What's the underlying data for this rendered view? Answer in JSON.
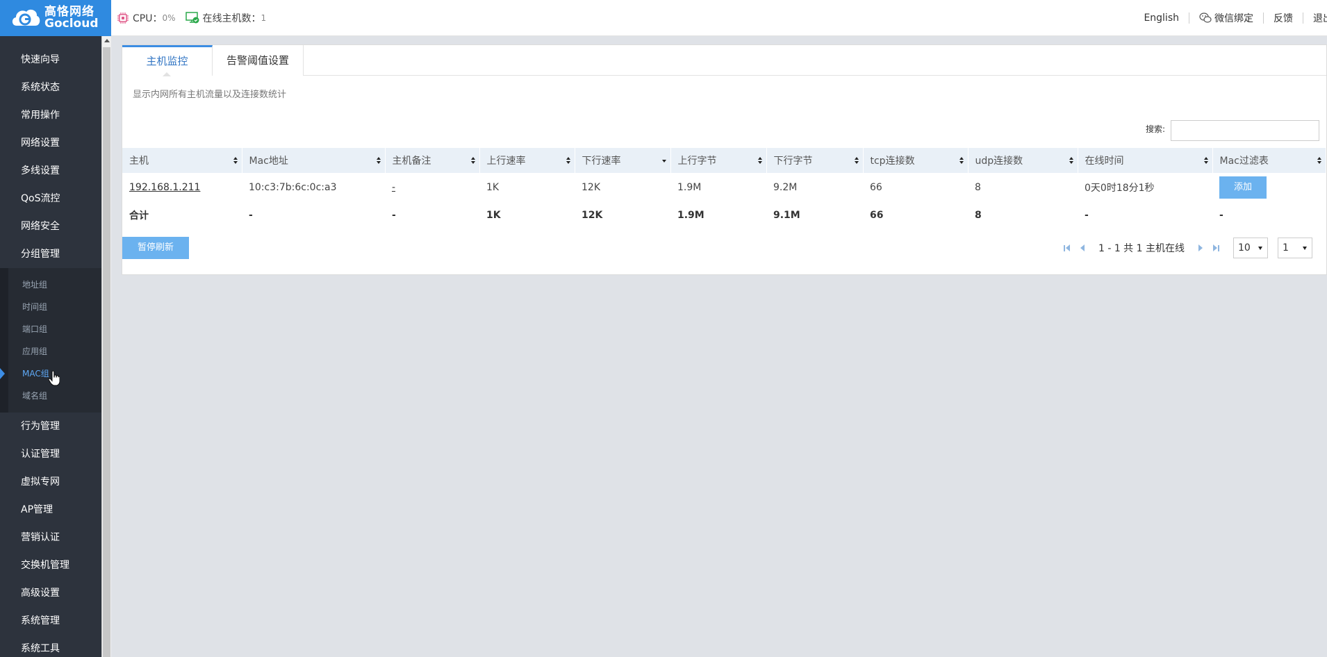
{
  "brand": {
    "name_cn": "高恪网络",
    "name_en": "Gocloud"
  },
  "header": {
    "cpu_label": "CPU：",
    "cpu_value": "0%",
    "online_label": "在线主机数：",
    "online_value": "1",
    "english": "English",
    "wechat": "微信绑定",
    "feedback": "反馈",
    "logout": "退出"
  },
  "sidebar": {
    "items_top": [
      {
        "label": "快速向导"
      },
      {
        "label": "系统状态"
      },
      {
        "label": "常用操作"
      },
      {
        "label": "网络设置"
      },
      {
        "label": "多线设置"
      },
      {
        "label": "QoS流控"
      },
      {
        "label": "网络安全"
      },
      {
        "label": "分组管理"
      }
    ],
    "submenu": [
      {
        "label": "地址组"
      },
      {
        "label": "时间组"
      },
      {
        "label": "端口组"
      },
      {
        "label": "应用组"
      },
      {
        "label": "MAC组"
      },
      {
        "label": "域名组"
      }
    ],
    "items_bottom": [
      {
        "label": "行为管理"
      },
      {
        "label": "认证管理"
      },
      {
        "label": "虚拟专网"
      },
      {
        "label": "AP管理"
      },
      {
        "label": "营销认证"
      },
      {
        "label": "交换机管理"
      },
      {
        "label": "高级设置"
      },
      {
        "label": "系统管理"
      },
      {
        "label": "系统工具"
      }
    ]
  },
  "tabs": [
    {
      "label": "主机监控"
    },
    {
      "label": "告警阈值设置"
    }
  ],
  "description": "显示内网所有主机流量以及连接数统计",
  "search": {
    "label": "搜索:",
    "value": ""
  },
  "table": {
    "columns": [
      "主机",
      "Mac地址",
      "主机备注",
      "上行速率",
      "下行速率",
      "上行字节",
      "下行字节",
      "tcp连接数",
      "udp连接数",
      "在线时间",
      "Mac过滤表"
    ],
    "rows": [
      {
        "host": "192.168.1.211",
        "mac": "10:c3:7b:6c:0c:a3",
        "note": "-",
        "up_rate": "1K",
        "down_rate": "12K",
        "up_bytes": "1.9M",
        "down_bytes": "9.2M",
        "tcp": "66",
        "udp": "8",
        "online_time": "0天0时18分1秒",
        "filter_action": "添加"
      }
    ],
    "total": {
      "label": "合计",
      "mac": "-",
      "note": "-",
      "up_rate": "1K",
      "down_rate": "12K",
      "up_bytes": "1.9M",
      "down_bytes": "9.1M",
      "tcp": "66",
      "udp": "8",
      "online_time": "-",
      "filter": "-"
    }
  },
  "actions": {
    "pause_refresh": "暂停刷新"
  },
  "pager": {
    "info": "1 - 1 共 1 主机在线",
    "page_size": "10",
    "page": "1"
  },
  "colors": {
    "accent": "#2f8ae0",
    "button": "#6bb2ef",
    "sidebar_bg": "#2d333d"
  }
}
